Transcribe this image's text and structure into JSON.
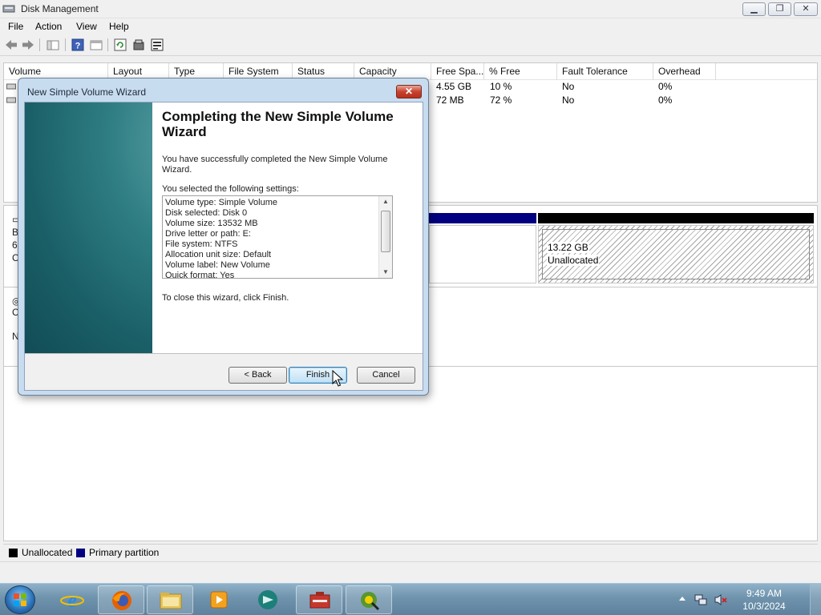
{
  "window": {
    "title": "Disk Management",
    "min_glyph": "▁",
    "restore_glyph": "❐",
    "close_glyph": "✕"
  },
  "menu": [
    "File",
    "Action",
    "View",
    "Help"
  ],
  "toolbar_icons": [
    "back-icon",
    "forward-icon",
    "show-hide-tree-icon",
    "help-icon",
    "properties-icon",
    "refresh-icon",
    "disk-properties-icon",
    "rescan-icon"
  ],
  "volume_list": {
    "columns": [
      "Volume",
      "Layout",
      "Type",
      "File System",
      "Status",
      "Capacity",
      "Free Spa...",
      "% Free",
      "Fault Tolerance",
      "Overhead"
    ],
    "rows": [
      {
        "free": "4.55 GB",
        "pct_free": "10 %",
        "fault_tolerance": "No",
        "overhead": "0%"
      },
      {
        "free": "72 MB",
        "pct_free": "72 %",
        "fault_tolerance": "No",
        "overhead": "0%"
      }
    ]
  },
  "disk_map": {
    "unallocated_size": "13.22 GB",
    "unallocated_label": "Unallocated",
    "stub_labels": [
      "B",
      "6",
      "C",
      "C",
      "N"
    ]
  },
  "legend": [
    {
      "label": "Unallocated",
      "color": "#000000"
    },
    {
      "label": "Primary partition",
      "color": "#000080"
    }
  ],
  "wizard": {
    "title": "New Simple Volume Wizard",
    "heading": "Completing the New Simple Volume Wizard",
    "success_text": "You have successfully completed the New Simple Volume Wizard.",
    "settings_label": "You selected the following settings:",
    "settings": [
      "Volume type: Simple Volume",
      "Disk selected: Disk 0",
      "Volume size: 13532 MB",
      "Drive letter or path: E:",
      "File system: NTFS",
      "Allocation unit size: Default",
      "Volume label: New Volume",
      "Quick format: Yes"
    ],
    "close_hint": "To close this wizard, click Finish.",
    "buttons": {
      "back": "< Back",
      "finish": "Finish",
      "cancel": "Cancel"
    },
    "close_glyph": "✕"
  },
  "taskbar": {
    "items": [
      "internet-explorer-icon",
      "firefox-icon",
      "file-explorer-icon",
      "media-player-icon",
      "network-app-icon",
      "computer-management-icon",
      "qgis-icon"
    ],
    "time": "9:49 AM",
    "date": "10/3/2024"
  }
}
